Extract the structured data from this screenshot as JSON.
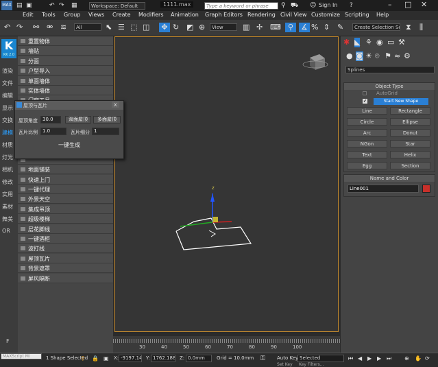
{
  "titlebar": {
    "workspace": "Workspace: Default",
    "file": "1111.max",
    "search_placeholder": "Type a keyword or phrase",
    "signin": "Sign In",
    "help": "?"
  },
  "menu": [
    "Edit",
    "Tools",
    "Group",
    "Views",
    "Create",
    "Modifiers",
    "Animation",
    "Graph Editors",
    "Rendering",
    "Civil View",
    "Customize",
    "Scripting",
    "Help"
  ],
  "toolbar": {
    "selection_filter": "All",
    "view_dropdown": "View",
    "create_selection_set": "Create Selection Se"
  },
  "sidebar": {
    "logo_letter": "K",
    "logo_version": "KK 2.0",
    "items": [
      "渲染",
      "文件",
      "编辑",
      "显示",
      "交换",
      "建模",
      "材质",
      "灯光",
      "相机",
      "修改",
      "实用",
      "素材",
      "舞美",
      "OR"
    ],
    "bottom": "F"
  },
  "plugin_list": [
    "重置物体",
    "墙贴",
    "分面",
    "户型导入",
    "单面墙体",
    "实体墙体",
    "门窗工具",
    "",
    "",
    "",
    "",
    "",
    "",
    "地面铺装",
    "快速上门",
    "一键代理",
    "外景天空",
    "集成吊顶",
    "超级楼梯",
    "层花脚线",
    "一键酒柜",
    "波打线",
    "屋顶瓦片",
    "背景遮罩",
    "屏风隔断"
  ],
  "dialog": {
    "title": "屋顶与瓦片",
    "close": "x",
    "roof_angle_label": "屋顶角度",
    "roof_angle_value": "30.0",
    "double_roof": "双面屋顶",
    "multi_roof": "多面屋顶",
    "tile_ratio_label": "瓦片比例",
    "tile_ratio_value": "1.0",
    "tile_subdiv_label": "瓦片细分",
    "tile_subdiv_value": "1",
    "generate": "一键生成"
  },
  "viewport": {
    "axis_z": "z"
  },
  "timeline": {
    "ticks": [
      "30",
      "40",
      "50",
      "60",
      "70",
      "80",
      "90",
      "100"
    ]
  },
  "command_panel": {
    "category": "Splines",
    "object_type_header": "Object Type",
    "autogrid": "AutoGrid",
    "start_new_shape": "Start New Shape",
    "buttons": [
      "Line",
      "Rectangle",
      "Circle",
      "Ellipse",
      "Arc",
      "Donut",
      "NGon",
      "Star",
      "Text",
      "Helix",
      "Egg",
      "Section"
    ],
    "name_color_header": "Name and Color",
    "object_name": "Line001",
    "object_color": "#c8302a"
  },
  "status": {
    "maxscript": "MAXScript Mi",
    "selected_count": "1 Shape Selected",
    "x_label": "X:",
    "x_value": "-9197.143",
    "y_label": "Y:",
    "y_value": "1762.188",
    "z_label": "Z:",
    "z_value": "0.0mm",
    "grid": "Grid = 10.0mm",
    "auto_key": "Auto Key",
    "selected_dd": "Selected",
    "set_key": "Set Key",
    "key_filters": "Key Filters..."
  },
  "colors": {
    "accent": "#2a7fd4",
    "viewport_border": "#c98d2d",
    "logo_bg": "#1a86d0"
  }
}
